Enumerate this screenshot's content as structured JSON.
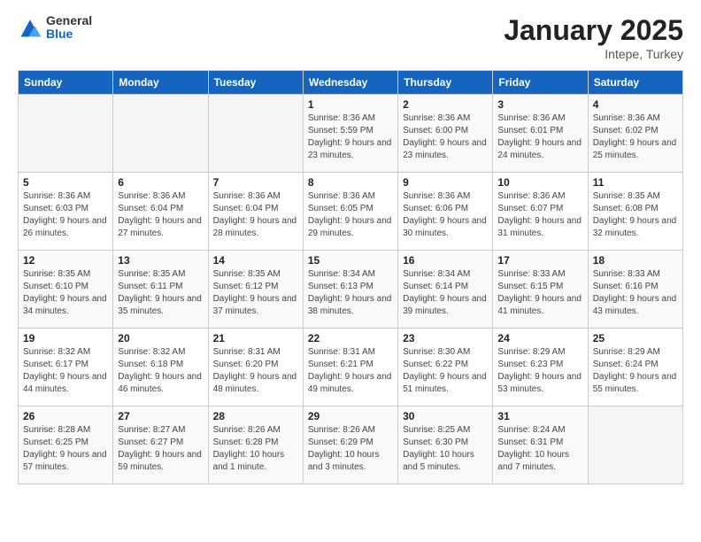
{
  "logo": {
    "general": "General",
    "blue": "Blue"
  },
  "header": {
    "month": "January 2025",
    "location": "Intepe, Turkey"
  },
  "days_of_week": [
    "Sunday",
    "Monday",
    "Tuesday",
    "Wednesday",
    "Thursday",
    "Friday",
    "Saturday"
  ],
  "weeks": [
    [
      {
        "day": "",
        "sunrise": "",
        "sunset": "",
        "daylight": ""
      },
      {
        "day": "",
        "sunrise": "",
        "sunset": "",
        "daylight": ""
      },
      {
        "day": "",
        "sunrise": "",
        "sunset": "",
        "daylight": ""
      },
      {
        "day": "1",
        "sunrise": "Sunrise: 8:36 AM",
        "sunset": "Sunset: 5:59 PM",
        "daylight": "Daylight: 9 hours and 23 minutes."
      },
      {
        "day": "2",
        "sunrise": "Sunrise: 8:36 AM",
        "sunset": "Sunset: 6:00 PM",
        "daylight": "Daylight: 9 hours and 23 minutes."
      },
      {
        "day": "3",
        "sunrise": "Sunrise: 8:36 AM",
        "sunset": "Sunset: 6:01 PM",
        "daylight": "Daylight: 9 hours and 24 minutes."
      },
      {
        "day": "4",
        "sunrise": "Sunrise: 8:36 AM",
        "sunset": "Sunset: 6:02 PM",
        "daylight": "Daylight: 9 hours and 25 minutes."
      }
    ],
    [
      {
        "day": "5",
        "sunrise": "Sunrise: 8:36 AM",
        "sunset": "Sunset: 6:03 PM",
        "daylight": "Daylight: 9 hours and 26 minutes."
      },
      {
        "day": "6",
        "sunrise": "Sunrise: 8:36 AM",
        "sunset": "Sunset: 6:04 PM",
        "daylight": "Daylight: 9 hours and 27 minutes."
      },
      {
        "day": "7",
        "sunrise": "Sunrise: 8:36 AM",
        "sunset": "Sunset: 6:04 PM",
        "daylight": "Daylight: 9 hours and 28 minutes."
      },
      {
        "day": "8",
        "sunrise": "Sunrise: 8:36 AM",
        "sunset": "Sunset: 6:05 PM",
        "daylight": "Daylight: 9 hours and 29 minutes."
      },
      {
        "day": "9",
        "sunrise": "Sunrise: 8:36 AM",
        "sunset": "Sunset: 6:06 PM",
        "daylight": "Daylight: 9 hours and 30 minutes."
      },
      {
        "day": "10",
        "sunrise": "Sunrise: 8:36 AM",
        "sunset": "Sunset: 6:07 PM",
        "daylight": "Daylight: 9 hours and 31 minutes."
      },
      {
        "day": "11",
        "sunrise": "Sunrise: 8:35 AM",
        "sunset": "Sunset: 6:08 PM",
        "daylight": "Daylight: 9 hours and 32 minutes."
      }
    ],
    [
      {
        "day": "12",
        "sunrise": "Sunrise: 8:35 AM",
        "sunset": "Sunset: 6:10 PM",
        "daylight": "Daylight: 9 hours and 34 minutes."
      },
      {
        "day": "13",
        "sunrise": "Sunrise: 8:35 AM",
        "sunset": "Sunset: 6:11 PM",
        "daylight": "Daylight: 9 hours and 35 minutes."
      },
      {
        "day": "14",
        "sunrise": "Sunrise: 8:35 AM",
        "sunset": "Sunset: 6:12 PM",
        "daylight": "Daylight: 9 hours and 37 minutes."
      },
      {
        "day": "15",
        "sunrise": "Sunrise: 8:34 AM",
        "sunset": "Sunset: 6:13 PM",
        "daylight": "Daylight: 9 hours and 38 minutes."
      },
      {
        "day": "16",
        "sunrise": "Sunrise: 8:34 AM",
        "sunset": "Sunset: 6:14 PM",
        "daylight": "Daylight: 9 hours and 39 minutes."
      },
      {
        "day": "17",
        "sunrise": "Sunrise: 8:33 AM",
        "sunset": "Sunset: 6:15 PM",
        "daylight": "Daylight: 9 hours and 41 minutes."
      },
      {
        "day": "18",
        "sunrise": "Sunrise: 8:33 AM",
        "sunset": "Sunset: 6:16 PM",
        "daylight": "Daylight: 9 hours and 43 minutes."
      }
    ],
    [
      {
        "day": "19",
        "sunrise": "Sunrise: 8:32 AM",
        "sunset": "Sunset: 6:17 PM",
        "daylight": "Daylight: 9 hours and 44 minutes."
      },
      {
        "day": "20",
        "sunrise": "Sunrise: 8:32 AM",
        "sunset": "Sunset: 6:18 PM",
        "daylight": "Daylight: 9 hours and 46 minutes."
      },
      {
        "day": "21",
        "sunrise": "Sunrise: 8:31 AM",
        "sunset": "Sunset: 6:20 PM",
        "daylight": "Daylight: 9 hours and 48 minutes."
      },
      {
        "day": "22",
        "sunrise": "Sunrise: 8:31 AM",
        "sunset": "Sunset: 6:21 PM",
        "daylight": "Daylight: 9 hours and 49 minutes."
      },
      {
        "day": "23",
        "sunrise": "Sunrise: 8:30 AM",
        "sunset": "Sunset: 6:22 PM",
        "daylight": "Daylight: 9 hours and 51 minutes."
      },
      {
        "day": "24",
        "sunrise": "Sunrise: 8:29 AM",
        "sunset": "Sunset: 6:23 PM",
        "daylight": "Daylight: 9 hours and 53 minutes."
      },
      {
        "day": "25",
        "sunrise": "Sunrise: 8:29 AM",
        "sunset": "Sunset: 6:24 PM",
        "daylight": "Daylight: 9 hours and 55 minutes."
      }
    ],
    [
      {
        "day": "26",
        "sunrise": "Sunrise: 8:28 AM",
        "sunset": "Sunset: 6:25 PM",
        "daylight": "Daylight: 9 hours and 57 minutes."
      },
      {
        "day": "27",
        "sunrise": "Sunrise: 8:27 AM",
        "sunset": "Sunset: 6:27 PM",
        "daylight": "Daylight: 9 hours and 59 minutes."
      },
      {
        "day": "28",
        "sunrise": "Sunrise: 8:26 AM",
        "sunset": "Sunset: 6:28 PM",
        "daylight": "Daylight: 10 hours and 1 minute."
      },
      {
        "day": "29",
        "sunrise": "Sunrise: 8:26 AM",
        "sunset": "Sunset: 6:29 PM",
        "daylight": "Daylight: 10 hours and 3 minutes."
      },
      {
        "day": "30",
        "sunrise": "Sunrise: 8:25 AM",
        "sunset": "Sunset: 6:30 PM",
        "daylight": "Daylight: 10 hours and 5 minutes."
      },
      {
        "day": "31",
        "sunrise": "Sunrise: 8:24 AM",
        "sunset": "Sunset: 6:31 PM",
        "daylight": "Daylight: 10 hours and 7 minutes."
      },
      {
        "day": "",
        "sunrise": "",
        "sunset": "",
        "daylight": ""
      }
    ]
  ]
}
